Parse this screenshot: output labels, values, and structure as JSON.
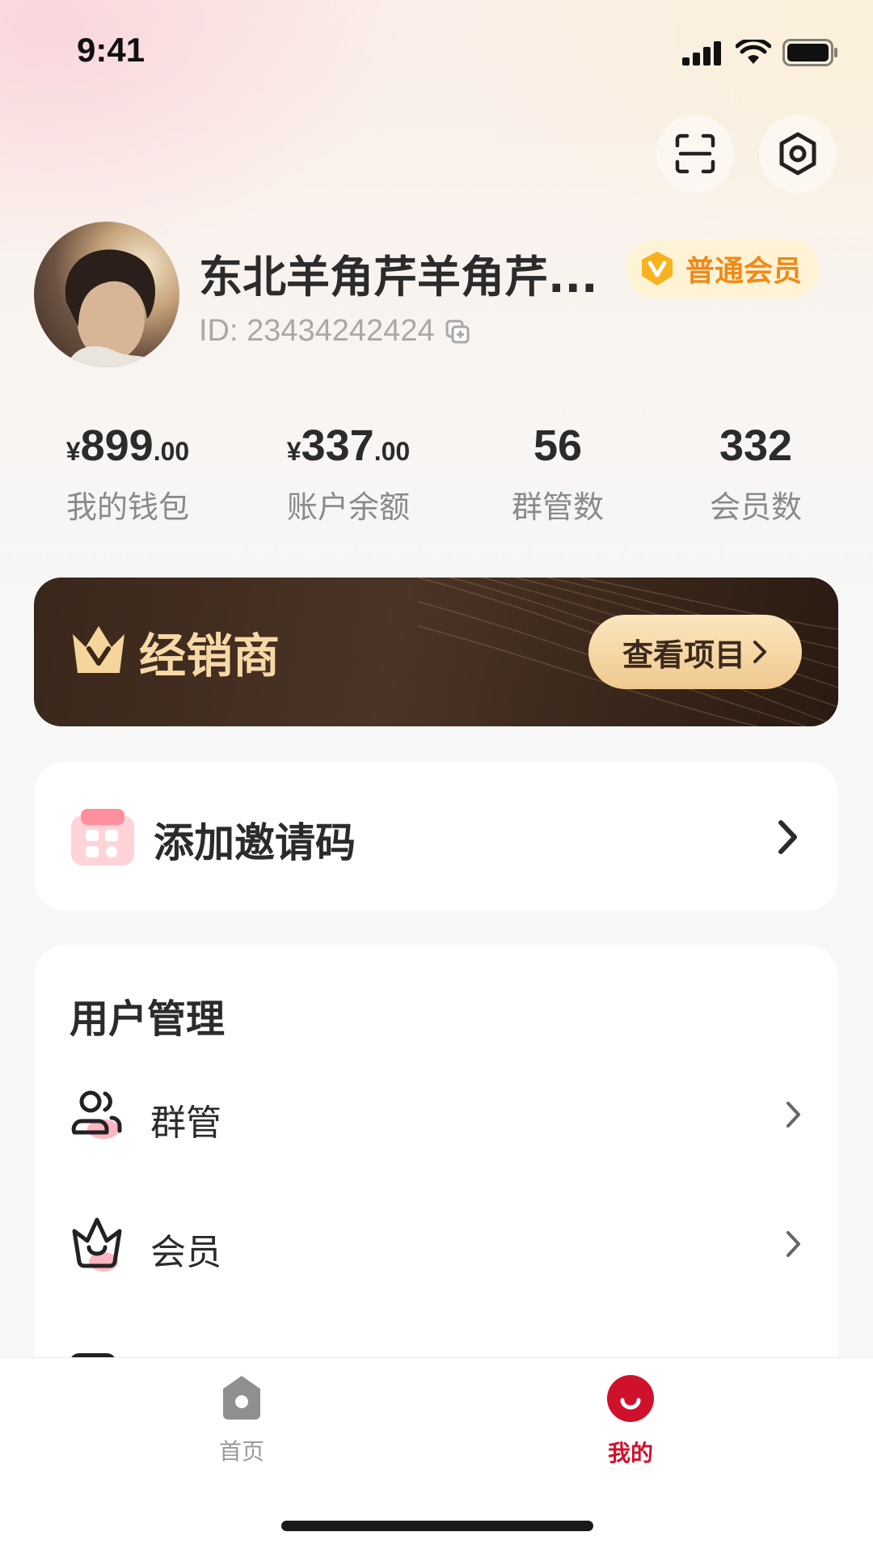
{
  "status_bar": {
    "time": "9:41"
  },
  "profile": {
    "name": "东北羊角芹羊角芹...",
    "member_level": "普通会员",
    "id_text": "ID: 23434242424"
  },
  "stats": [
    {
      "currency": "¥",
      "integer": "899",
      "decimal": ".00",
      "label": "我的钱包"
    },
    {
      "currency": "¥",
      "integer": "337",
      "decimal": ".00",
      "label": "账户余额"
    },
    {
      "integer": "56",
      "label": "群管数"
    },
    {
      "integer": "332",
      "label": "会员数"
    }
  ],
  "dealer": {
    "title": "经销商",
    "button": "查看项目"
  },
  "invite": {
    "label": "添加邀请码"
  },
  "user_management": {
    "title": "用户管理",
    "items": [
      {
        "label": "群管"
      },
      {
        "label": "会员"
      }
    ]
  },
  "tabbar": {
    "items": [
      {
        "label": "首页",
        "active": false
      },
      {
        "label": "我的",
        "active": true
      }
    ],
    "active_color": "#d0112b",
    "inactive_color": "#9a9a9a"
  },
  "colors": {
    "accent": "#d0112b",
    "badge_text": "#f08a16",
    "dealer_gold": "#f6d9a6"
  }
}
